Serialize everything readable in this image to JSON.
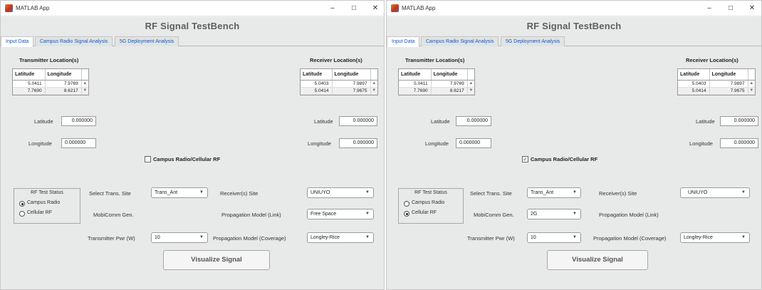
{
  "windows": [
    {
      "titlebar": {
        "title": "MATLAB App",
        "minimize": "–",
        "maximize": "□",
        "close": "✕"
      },
      "heading": "RF Signal TestBench",
      "tabs": [
        "Input Data",
        "Campus Radio Signal Analysis",
        "5G Deployment Analysis"
      ],
      "transmitter": {
        "title": "Transmitter Location(s)",
        "headers": [
          "Latitude",
          "Longitude"
        ],
        "rows": [
          [
            "5.0411",
            "7.9769"
          ],
          [
            "7.7690",
            "8.6217"
          ]
        ]
      },
      "receiver": {
        "title": "Receiver Location(s)",
        "headers": [
          "Latitude",
          "Longitude"
        ],
        "rows": [
          [
            "5.0403",
            "7.9897"
          ],
          [
            "5.0414",
            "7.9675"
          ]
        ]
      },
      "tx_inputs": {
        "lat_label": "Latitude",
        "lat_value": "0.000000",
        "lon_label": "Longitude",
        "lon_value": "0.000000"
      },
      "rx_inputs": {
        "lat_label": "Latitude",
        "lat_value": "0.000000",
        "lon_label": "Longitude",
        "lon_value": "0.000000"
      },
      "checkbox": {
        "label": "Campus Radio/Cellular RF",
        "checked": false
      },
      "status_group": {
        "title": "RF Test Status",
        "options": [
          "Campus Radio",
          "Cellular RF"
        ],
        "selected": 0
      },
      "controls": {
        "trans_site_label": "Select Trans. Site",
        "trans_site_value": "Trans_Ant",
        "receiver_site_label": "Receiver(s) Site",
        "receiver_site_value": "UNIUYO",
        "mobicomm_label": "MobiComm Gen.",
        "mobicomm_value": "",
        "prop_link_label": "Propagation Model (Link)",
        "prop_link_value": "Free Space",
        "tx_power_label": "Transmitter Pwr (W)",
        "tx_power_value": "10",
        "prop_cov_label": "Propagation Model (Coverage)",
        "prop_cov_value": "Longley-Rice"
      },
      "button": "Visualize Signal"
    },
    {
      "titlebar": {
        "title": "MATLAB App",
        "minimize": "–",
        "maximize": "□",
        "close": "✕"
      },
      "heading": "RF Signal TestBench",
      "tabs": [
        "Input Data",
        "Campus Radio Signal Analysis",
        "5G Deployment Analysis"
      ],
      "transmitter": {
        "title": "Transmitter Location(s)",
        "headers": [
          "Latitude",
          "Longitude"
        ],
        "rows": [
          [
            "5.0411",
            "7.9769"
          ],
          [
            "7.7690",
            "8.6217"
          ]
        ]
      },
      "receiver": {
        "title": "Receiver Location(s)",
        "headers": [
          "Latitude",
          "Longitude"
        ],
        "rows": [
          [
            "5.0403",
            "7.9897"
          ],
          [
            "5.0414",
            "7.9675"
          ]
        ]
      },
      "tx_inputs": {
        "lat_label": "Latitude",
        "lat_value": "0.000000",
        "lon_label": "Longitude",
        "lon_value": "0.000000"
      },
      "rx_inputs": {
        "lat_label": "Latitude",
        "lat_value": "0.000000",
        "lon_label": "Longitude",
        "lon_value": "0.000000"
      },
      "checkbox": {
        "label": "Campus Radio/Cellular RF",
        "checked": true
      },
      "status_group": {
        "title": "RF Test Status",
        "options": [
          "Campus Radio",
          "Cellular RF"
        ],
        "selected": 1
      },
      "controls": {
        "trans_site_label": "Select Trans. Site",
        "trans_site_value": "Trans_Ant",
        "receiver_site_label": "Receiver(s) Site",
        "receiver_site_value": "UNIUYO",
        "mobicomm_label": "MobiComm Gen.",
        "mobicomm_value": "2G",
        "prop_link_label": "Propagation Model (Link)",
        "prop_link_value": "",
        "tx_power_label": "Transmitter Pwr (W)",
        "tx_power_value": "10",
        "prop_cov_label": "Propagation Model (Coverage)",
        "prop_cov_value": "Longley-Rice"
      },
      "button": "Visualize Signal"
    }
  ],
  "icons": {
    "app": "matlab-icon",
    "dropdown": "chevron-down-icon",
    "check": "checkmark-icon"
  }
}
